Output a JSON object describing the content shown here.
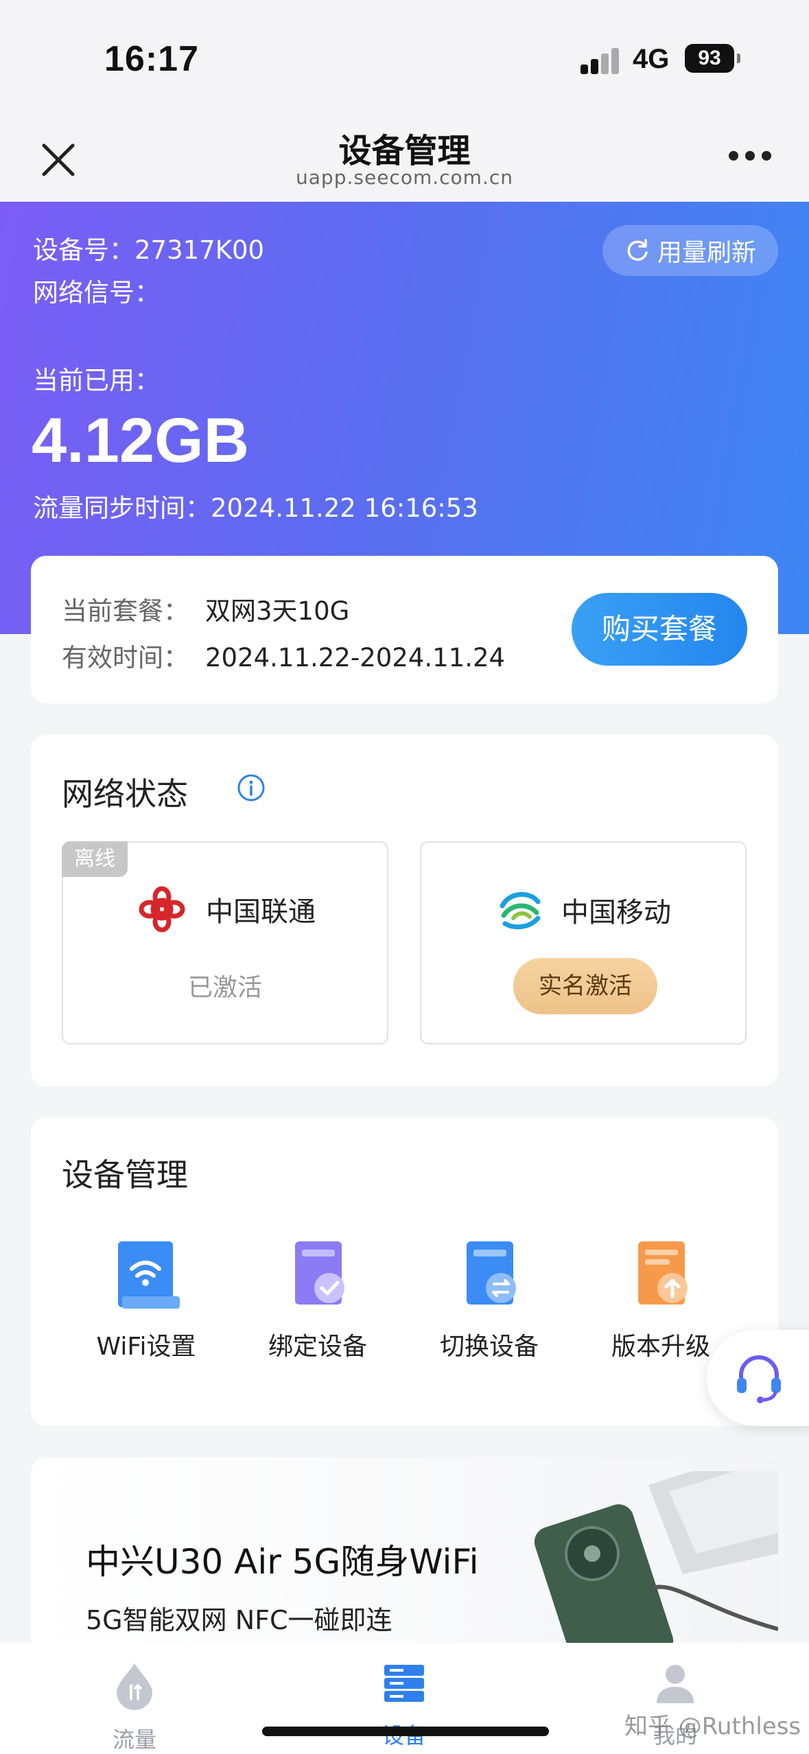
{
  "status_bar": {
    "time": "16:17",
    "network": "4G",
    "battery": "93"
  },
  "nav": {
    "title": "设备管理",
    "url": "uapp.seecom.com.cn"
  },
  "hero": {
    "device_label": "设备号：",
    "device_id": "27317K00",
    "signal_label": "网络信号：",
    "refresh_label": "用量刷新",
    "used_label": "当前已用：",
    "used_value": "4.12GB",
    "sync_label": "流量同步时间：",
    "sync_time": "2024.11.22 16:16:53"
  },
  "plan": {
    "package_label": "当前套餐：",
    "package_value": "双网3天10G",
    "valid_label": "有效时间：",
    "valid_value": "2024.11.22-2024.11.24",
    "buy_label": "购买套餐"
  },
  "network_status": {
    "title": "网络状态",
    "carriers": [
      {
        "name": "中国联通",
        "tag": "离线",
        "status": "已激活"
      },
      {
        "name": "中国移动",
        "action": "实名激活"
      }
    ]
  },
  "device_mgmt": {
    "title": "设备管理",
    "tools": [
      {
        "label": "WiFi设置",
        "icon": "wifi-icon",
        "color": "#3b8cf4"
      },
      {
        "label": "绑定设备",
        "icon": "bind-device-icon",
        "color": "#8b7cf6"
      },
      {
        "label": "切换设备",
        "icon": "switch-device-icon",
        "color": "#3b8cf4"
      },
      {
        "label": "版本升级",
        "icon": "upgrade-icon",
        "color": "#f7994a"
      }
    ]
  },
  "promo": {
    "title": "中兴U30 Air 5G随身WiFi",
    "subtitle": "5G智能双网   NFC一碰即连"
  },
  "tabbar": {
    "tabs": [
      {
        "label": "流量",
        "active": false
      },
      {
        "label": "设备",
        "active": true
      },
      {
        "label": "我的",
        "active": false
      }
    ]
  },
  "watermark": "知乎 @Ruthless",
  "colors": {
    "accent": "#3e86f3",
    "hero_start": "#7b5df5",
    "active_tab": "#2f80ed",
    "inactive_tab": "#b8bdc6"
  }
}
